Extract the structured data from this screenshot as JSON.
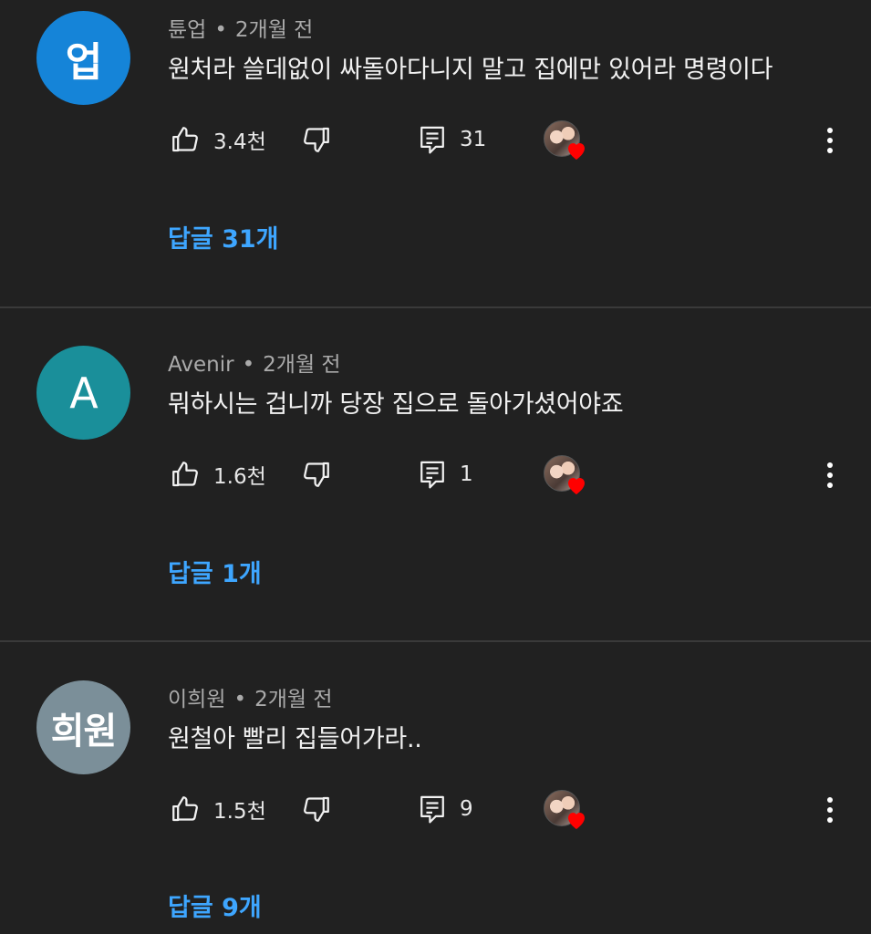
{
  "comments": [
    {
      "avatar_text": "업",
      "avatar_color": "#1584d8",
      "author": "튠업",
      "time": "2개월 전",
      "text": "원처라 쓸데없이 싸돌아다니지 말고 집에만 있어라 명령이다",
      "likes": "3.4천",
      "reply_count": "31",
      "replies_label": "답글 31개"
    },
    {
      "avatar_text": "A",
      "avatar_color": "#1a8f9a",
      "author": "Avenir",
      "time": "2개월 전",
      "text": "뭐하시는 겁니까 당장 집으로 돌아가셨어야죠",
      "likes": "1.6천",
      "reply_count": "1",
      "replies_label": "답글 1개"
    },
    {
      "avatar_text": "희원",
      "avatar_color": "#7b8f99",
      "author": "이희원",
      "time": "2개월 전",
      "text": "원철아 빨리 집들어가라..",
      "likes": "1.5천",
      "reply_count": "9",
      "replies_label": "답글 9개"
    }
  ],
  "meta_separator": "•",
  "icons": {
    "like": "thumbs-up-icon",
    "dislike": "thumbs-down-icon",
    "reply": "comment-icon",
    "creator_heart": "creator-heart-icon",
    "more": "more-vert-icon"
  },
  "colors": {
    "background": "#212121",
    "reply_link": "#3ea6ff",
    "heart": "#ff0000"
  }
}
